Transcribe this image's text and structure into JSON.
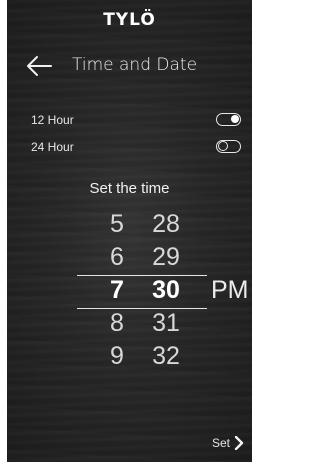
{
  "brand": {
    "logo_text": "TYLÖ"
  },
  "header": {
    "title": "Time and Date",
    "back_icon": "arrow-left-icon"
  },
  "format_options": [
    {
      "label": "12 Hour",
      "enabled": true
    },
    {
      "label": "24 Hour",
      "enabled": false
    }
  ],
  "picker": {
    "label": "Set the time",
    "hours": [
      "5",
      "6",
      "7",
      "8",
      "9"
    ],
    "minutes": [
      "28",
      "29",
      "30",
      "31",
      "32"
    ],
    "selected_hour": "7",
    "selected_minute": "30",
    "period": "PM"
  },
  "footer": {
    "set_label": "Set",
    "set_icon": "chevron-right-icon"
  },
  "colors": {
    "background": "#2a2a2a",
    "text": "#ececec",
    "frame": "#ffffff"
  }
}
